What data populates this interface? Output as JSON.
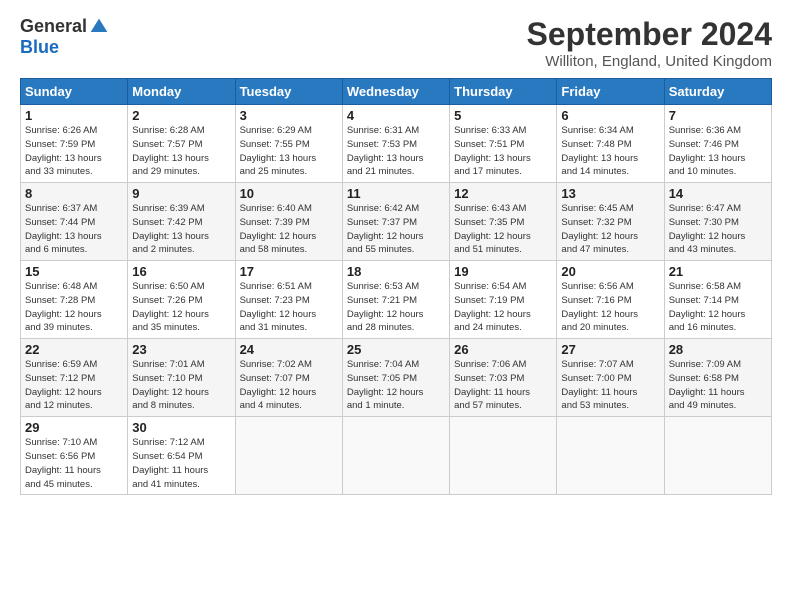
{
  "logo": {
    "general": "General",
    "blue": "Blue"
  },
  "title": "September 2024",
  "location": "Williton, England, United Kingdom",
  "days_of_week": [
    "Sunday",
    "Monday",
    "Tuesday",
    "Wednesday",
    "Thursday",
    "Friday",
    "Saturday"
  ],
  "weeks": [
    [
      {
        "day": "1",
        "info": "Sunrise: 6:26 AM\nSunset: 7:59 PM\nDaylight: 13 hours\nand 33 minutes."
      },
      {
        "day": "2",
        "info": "Sunrise: 6:28 AM\nSunset: 7:57 PM\nDaylight: 13 hours\nand 29 minutes."
      },
      {
        "day": "3",
        "info": "Sunrise: 6:29 AM\nSunset: 7:55 PM\nDaylight: 13 hours\nand 25 minutes."
      },
      {
        "day": "4",
        "info": "Sunrise: 6:31 AM\nSunset: 7:53 PM\nDaylight: 13 hours\nand 21 minutes."
      },
      {
        "day": "5",
        "info": "Sunrise: 6:33 AM\nSunset: 7:51 PM\nDaylight: 13 hours\nand 17 minutes."
      },
      {
        "day": "6",
        "info": "Sunrise: 6:34 AM\nSunset: 7:48 PM\nDaylight: 13 hours\nand 14 minutes."
      },
      {
        "day": "7",
        "info": "Sunrise: 6:36 AM\nSunset: 7:46 PM\nDaylight: 13 hours\nand 10 minutes."
      }
    ],
    [
      {
        "day": "8",
        "info": "Sunrise: 6:37 AM\nSunset: 7:44 PM\nDaylight: 13 hours\nand 6 minutes."
      },
      {
        "day": "9",
        "info": "Sunrise: 6:39 AM\nSunset: 7:42 PM\nDaylight: 13 hours\nand 2 minutes."
      },
      {
        "day": "10",
        "info": "Sunrise: 6:40 AM\nSunset: 7:39 PM\nDaylight: 12 hours\nand 58 minutes."
      },
      {
        "day": "11",
        "info": "Sunrise: 6:42 AM\nSunset: 7:37 PM\nDaylight: 12 hours\nand 55 minutes."
      },
      {
        "day": "12",
        "info": "Sunrise: 6:43 AM\nSunset: 7:35 PM\nDaylight: 12 hours\nand 51 minutes."
      },
      {
        "day": "13",
        "info": "Sunrise: 6:45 AM\nSunset: 7:32 PM\nDaylight: 12 hours\nand 47 minutes."
      },
      {
        "day": "14",
        "info": "Sunrise: 6:47 AM\nSunset: 7:30 PM\nDaylight: 12 hours\nand 43 minutes."
      }
    ],
    [
      {
        "day": "15",
        "info": "Sunrise: 6:48 AM\nSunset: 7:28 PM\nDaylight: 12 hours\nand 39 minutes."
      },
      {
        "day": "16",
        "info": "Sunrise: 6:50 AM\nSunset: 7:26 PM\nDaylight: 12 hours\nand 35 minutes."
      },
      {
        "day": "17",
        "info": "Sunrise: 6:51 AM\nSunset: 7:23 PM\nDaylight: 12 hours\nand 31 minutes."
      },
      {
        "day": "18",
        "info": "Sunrise: 6:53 AM\nSunset: 7:21 PM\nDaylight: 12 hours\nand 28 minutes."
      },
      {
        "day": "19",
        "info": "Sunrise: 6:54 AM\nSunset: 7:19 PM\nDaylight: 12 hours\nand 24 minutes."
      },
      {
        "day": "20",
        "info": "Sunrise: 6:56 AM\nSunset: 7:16 PM\nDaylight: 12 hours\nand 20 minutes."
      },
      {
        "day": "21",
        "info": "Sunrise: 6:58 AM\nSunset: 7:14 PM\nDaylight: 12 hours\nand 16 minutes."
      }
    ],
    [
      {
        "day": "22",
        "info": "Sunrise: 6:59 AM\nSunset: 7:12 PM\nDaylight: 12 hours\nand 12 minutes."
      },
      {
        "day": "23",
        "info": "Sunrise: 7:01 AM\nSunset: 7:10 PM\nDaylight: 12 hours\nand 8 minutes."
      },
      {
        "day": "24",
        "info": "Sunrise: 7:02 AM\nSunset: 7:07 PM\nDaylight: 12 hours\nand 4 minutes."
      },
      {
        "day": "25",
        "info": "Sunrise: 7:04 AM\nSunset: 7:05 PM\nDaylight: 12 hours\nand 1 minute."
      },
      {
        "day": "26",
        "info": "Sunrise: 7:06 AM\nSunset: 7:03 PM\nDaylight: 11 hours\nand 57 minutes."
      },
      {
        "day": "27",
        "info": "Sunrise: 7:07 AM\nSunset: 7:00 PM\nDaylight: 11 hours\nand 53 minutes."
      },
      {
        "day": "28",
        "info": "Sunrise: 7:09 AM\nSunset: 6:58 PM\nDaylight: 11 hours\nand 49 minutes."
      }
    ],
    [
      {
        "day": "29",
        "info": "Sunrise: 7:10 AM\nSunset: 6:56 PM\nDaylight: 11 hours\nand 45 minutes."
      },
      {
        "day": "30",
        "info": "Sunrise: 7:12 AM\nSunset: 6:54 PM\nDaylight: 11 hours\nand 41 minutes."
      },
      null,
      null,
      null,
      null,
      null
    ]
  ]
}
